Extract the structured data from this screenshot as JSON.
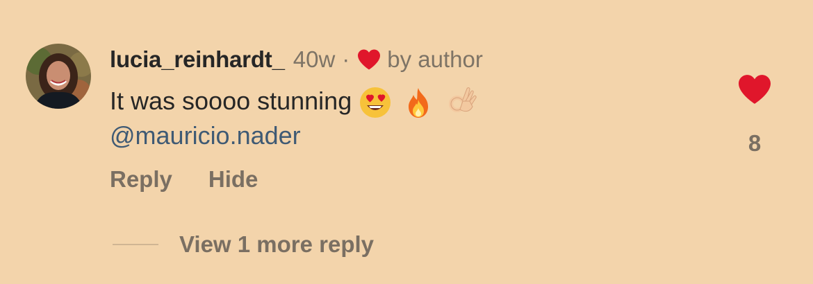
{
  "comment": {
    "username": "lucia_reinhardt_",
    "age": "40w",
    "separator": "·",
    "author_label": "by author",
    "text": "It was soooo stunning",
    "emojis": [
      "heart-eyes-emoji",
      "fire-emoji",
      "ok-hand-emoji"
    ],
    "mention": "@mauricio.nader",
    "like_count": "8"
  },
  "actions": {
    "reply_label": "Reply",
    "hide_label": "Hide"
  },
  "replies": {
    "view_more_label": "View 1 more reply"
  },
  "colors": {
    "background": "#f3d4ab",
    "heart": "#e0162b",
    "mention": "#3f5a74",
    "muted": "#7a6f62"
  }
}
